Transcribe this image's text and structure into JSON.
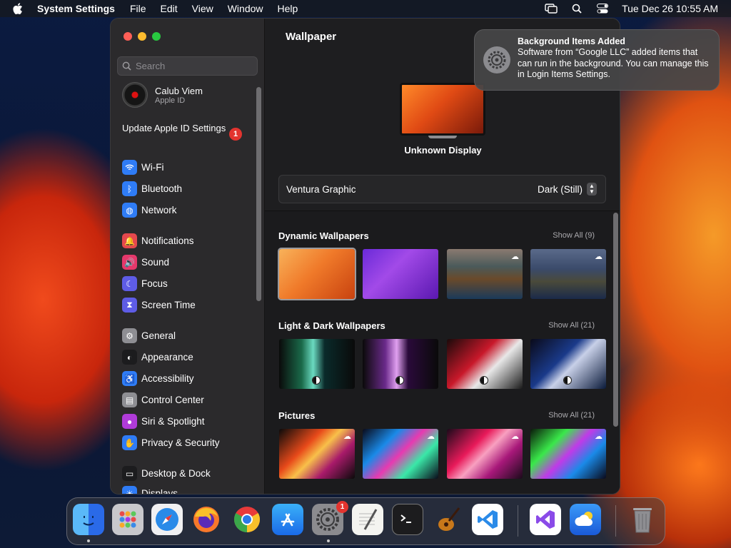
{
  "menubar": {
    "app": "System Settings",
    "items": [
      "File",
      "Edit",
      "View",
      "Window",
      "Help"
    ],
    "clock": "Tue Dec 26  10:55 AM"
  },
  "sidebar": {
    "search_placeholder": "Search",
    "account": {
      "name": "Calub Viem",
      "sub": "Apple ID"
    },
    "update": {
      "label": "Update Apple ID Settings",
      "badge": "1"
    },
    "items": [
      {
        "label": "Wi-Fi",
        "icon": "wifi-icon",
        "color": "#2f7cf6"
      },
      {
        "label": "Bluetooth",
        "icon": "bluetooth-icon",
        "color": "#2f7cf6"
      },
      {
        "label": "Network",
        "icon": "globe-icon",
        "color": "#2f7cf6"
      },
      {
        "label": "Notifications",
        "icon": "bell-icon",
        "color": "#e5484d"
      },
      {
        "label": "Sound",
        "icon": "speaker-icon",
        "color": "#e5386b"
      },
      {
        "label": "Focus",
        "icon": "moon-icon",
        "color": "#5e5ce6"
      },
      {
        "label": "Screen Time",
        "icon": "hourglass-icon",
        "color": "#5e5ce6"
      },
      {
        "label": "General",
        "icon": "gear-icon",
        "color": "#8e8e93"
      },
      {
        "label": "Appearance",
        "icon": "appearance-icon",
        "color": "#1c1c1e"
      },
      {
        "label": "Accessibility",
        "icon": "accessibility-icon",
        "color": "#2f7cf6"
      },
      {
        "label": "Control Center",
        "icon": "control-center-icon",
        "color": "#8e8e93"
      },
      {
        "label": "Siri & Spotlight",
        "icon": "siri-icon",
        "color": "#b03bd9"
      },
      {
        "label": "Privacy & Security",
        "icon": "hand-icon",
        "color": "#2f7cf6"
      },
      {
        "label": "Desktop & Dock",
        "icon": "dock-icon",
        "color": "#1c1c1e"
      },
      {
        "label": "Displays",
        "icon": "display-icon",
        "color": "#2f7cf6"
      }
    ]
  },
  "content": {
    "title": "Wallpaper",
    "display_name": "Unknown Display",
    "wallpaper_name": "Ventura Graphic",
    "wallpaper_mode": "Dark (Still)",
    "sections": [
      {
        "title": "Dynamic Wallpapers",
        "show_all": "Show All (9)"
      },
      {
        "title": "Light & Dark Wallpapers",
        "show_all": "Show All (21)"
      },
      {
        "title": "Pictures",
        "show_all": "Show All (21)"
      }
    ]
  },
  "notification": {
    "title": "Background Items Added",
    "body": "Software from “Google LLC” added items that can run in the background. You can manage this in Login Items Settings."
  },
  "dock": {
    "apps": [
      "Finder",
      "Launchpad",
      "Safari",
      "Firefox",
      "Google Chrome",
      "App Store",
      "System Settings",
      "TextEdit",
      "Terminal",
      "GarageBand",
      "Visual Studio Code",
      "Visual Studio",
      "Weather",
      "Trash"
    ],
    "settings_badge": "1"
  }
}
